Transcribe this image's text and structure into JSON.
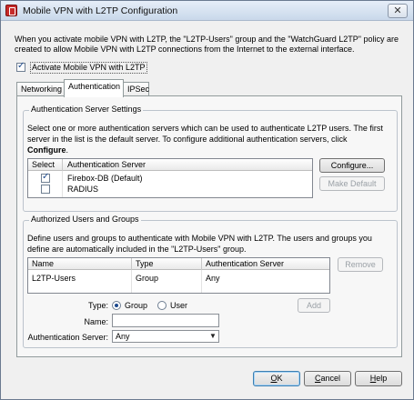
{
  "window": {
    "title": "Mobile VPN with L2TP Configuration",
    "close_glyph": "✕"
  },
  "intro_text": "When you activate mobile VPN with L2TP, the \"L2TP-Users\" group and the \"WatchGuard L2TP\" policy are created to allow Mobile VPN with L2TP connections from the Internet to the external interface.",
  "activate": {
    "label": "Activate Mobile VPN with L2TP",
    "checked": true
  },
  "tabs": [
    {
      "label": "Networking",
      "active": false
    },
    {
      "label": "Authentication",
      "active": true
    },
    {
      "label": "IPSec",
      "active": false
    }
  ],
  "auth_servers": {
    "title": "Authentication Server Settings",
    "desc_line1": "Select one or more authentication servers which can be used to authenticate L2TP users. The first",
    "desc_line2_pre": "server in the list is the default server. To configure additional authentication servers, click",
    "desc_line3_bold": "Configure",
    "desc_line3_post": ".",
    "columns": [
      "Select",
      "Authentication Server"
    ],
    "rows": [
      {
        "checked": true,
        "name": "Firebox-DB  (Default)"
      },
      {
        "checked": false,
        "name": "RADIUS"
      }
    ],
    "configure_label": "Configure...",
    "make_default_label": "Make Default"
  },
  "users_groups": {
    "title": "Authorized Users and Groups",
    "desc_line1": "Define users and groups to authenticate with Mobile VPN with L2TP. The users and groups you",
    "desc_line2": "define are automatically included in the \"L2TP-Users\" group.",
    "columns": [
      "Name",
      "Type",
      "Authentication Server"
    ],
    "rows": [
      {
        "name": "L2TP-Users",
        "type": "Group",
        "server": "Any"
      }
    ],
    "remove_label": "Remove",
    "add_label": "Add",
    "type_label": "Type:",
    "type_options": [
      {
        "label": "Group",
        "selected": true
      },
      {
        "label": "User",
        "selected": false
      }
    ],
    "name_label": "Name:",
    "name_value": "",
    "auth_server_label": "Authentication Server:",
    "auth_server_value": "Any"
  },
  "footer": {
    "ok_underline": "O",
    "ok_rest": "K",
    "cancel_underline": "C",
    "cancel_rest": "ancel",
    "help_underline": "H",
    "help_rest": "elp"
  },
  "colors": {
    "accent": "#1d4a8e",
    "panel_bg": "#f7f7f7",
    "window_bg": "#f0f0f0"
  }
}
